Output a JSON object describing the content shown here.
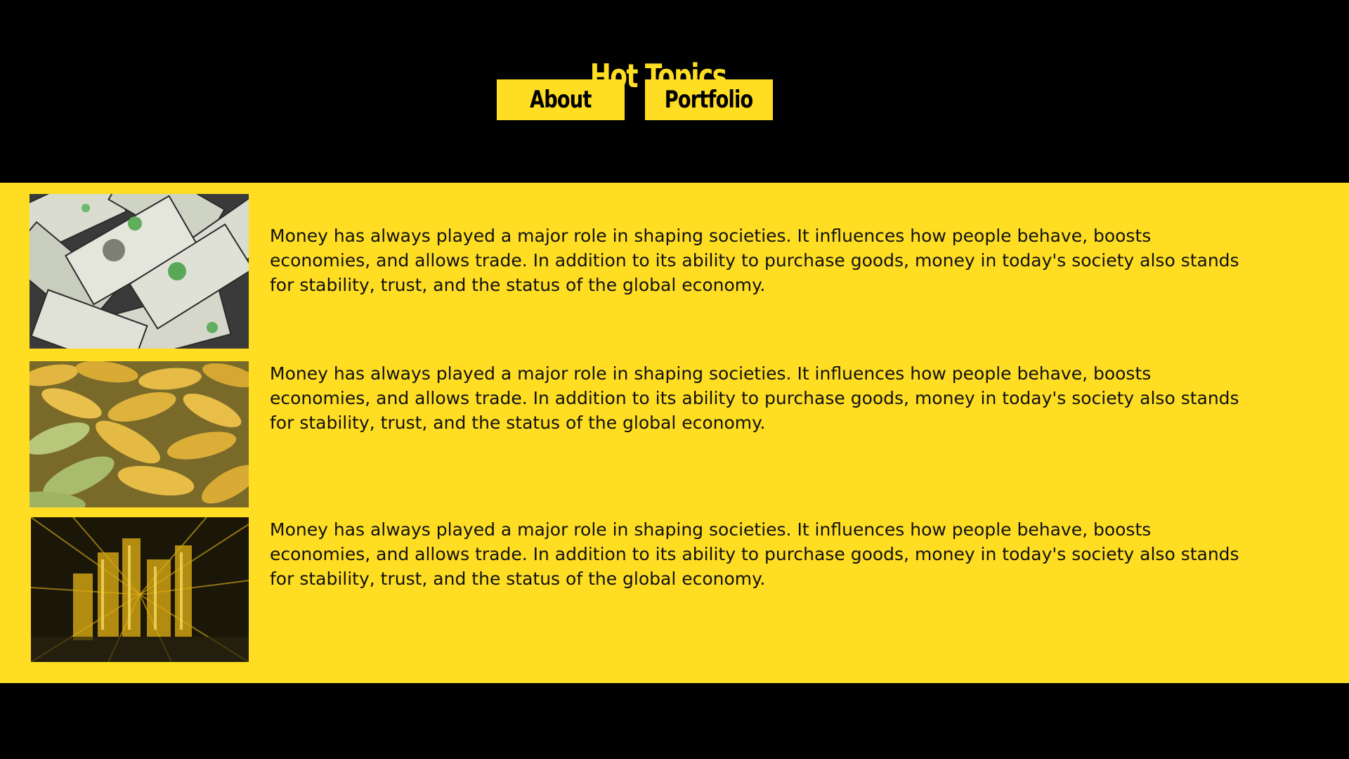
{
  "header": {
    "title": "Hot Topics",
    "nav": {
      "about_label": "About",
      "portfolio_label": "Portfolio"
    }
  },
  "articles": [
    {
      "image": "money-photo",
      "text": "Money has always played a major role in shaping societies. It influences how people behave, boosts economies, and allows trade. In addition to its ability to purchase goods, money in today's society also stands for stability, trust, and the status of the global economy."
    },
    {
      "image": "corn-photo",
      "text": "Money has always played a major role in shaping societies. It influences how people behave, boosts economies, and allows trade. In addition to its ability to purchase goods, money in today's society also stands for stability, trust, and the status of the global economy."
    },
    {
      "image": "city-lights-photo",
      "text": "Money has always played a major role in shaping societies. It influences how people behave, boosts economies, and allows trade. In addition to its ability to purchase goods, money in today's society also stands for stability, trust, and the status of the global economy."
    }
  ],
  "colors": {
    "background": "#000000",
    "accent": "#fedd22",
    "text": "#111111"
  }
}
